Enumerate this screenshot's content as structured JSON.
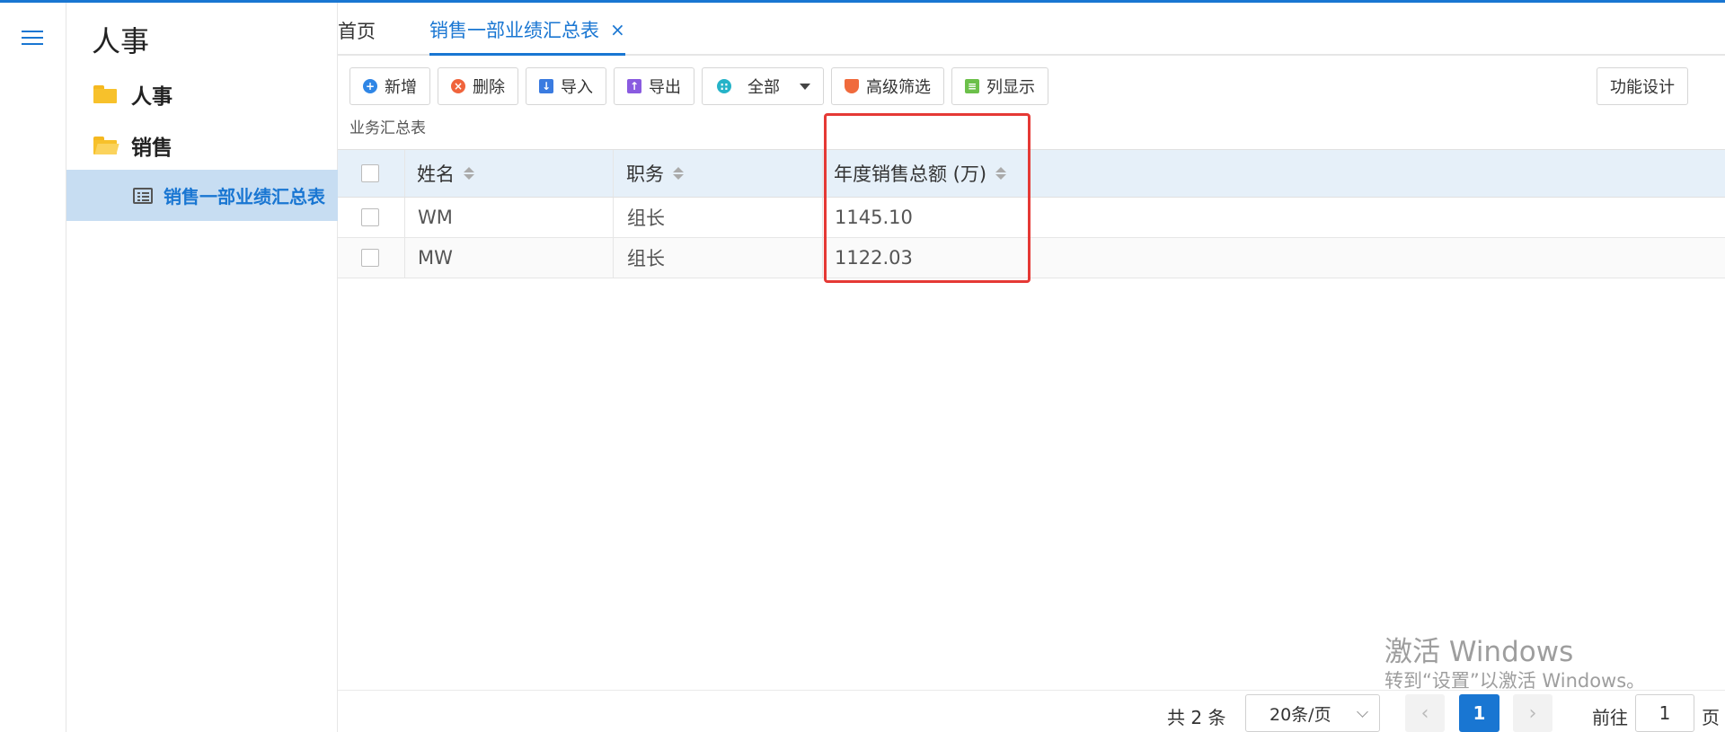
{
  "sidebar": {
    "title": "人事",
    "folders": [
      {
        "label": "人事"
      },
      {
        "label": "销售"
      }
    ],
    "active_item": "销售一部业绩汇总表"
  },
  "tabs": {
    "home": "首页",
    "active": "销售一部业绩汇总表",
    "close": "×"
  },
  "toolbar": {
    "add": "新增",
    "delete": "删除",
    "import": "导入",
    "export": "导出",
    "scope": "全部",
    "advanced_filter": "高级筛选",
    "columns": "列显示",
    "design": "功能设计"
  },
  "caption": "业务汇总表",
  "table": {
    "headers": [
      "姓名",
      "职务",
      "年度销售总额 (万)"
    ],
    "rows": [
      [
        "WM",
        "组长",
        "1145.10"
      ],
      [
        "MW",
        "组长",
        "1122.03"
      ]
    ]
  },
  "pagination": {
    "total": "共 2 条",
    "page_size": "20条/页",
    "prev": "‹",
    "current": "1",
    "next": "›",
    "goto_label": "前往",
    "goto_value": "1",
    "goto_suffix": "页"
  },
  "watermark": {
    "line1": "激活 Windows",
    "line2": "转到“设置”以激活 Windows。"
  },
  "colors": {
    "accent": "#1976d2",
    "highlight_border": "#e53935",
    "header_bg": "#e6f0f9",
    "active_nav_bg": "#c7ddf2"
  }
}
